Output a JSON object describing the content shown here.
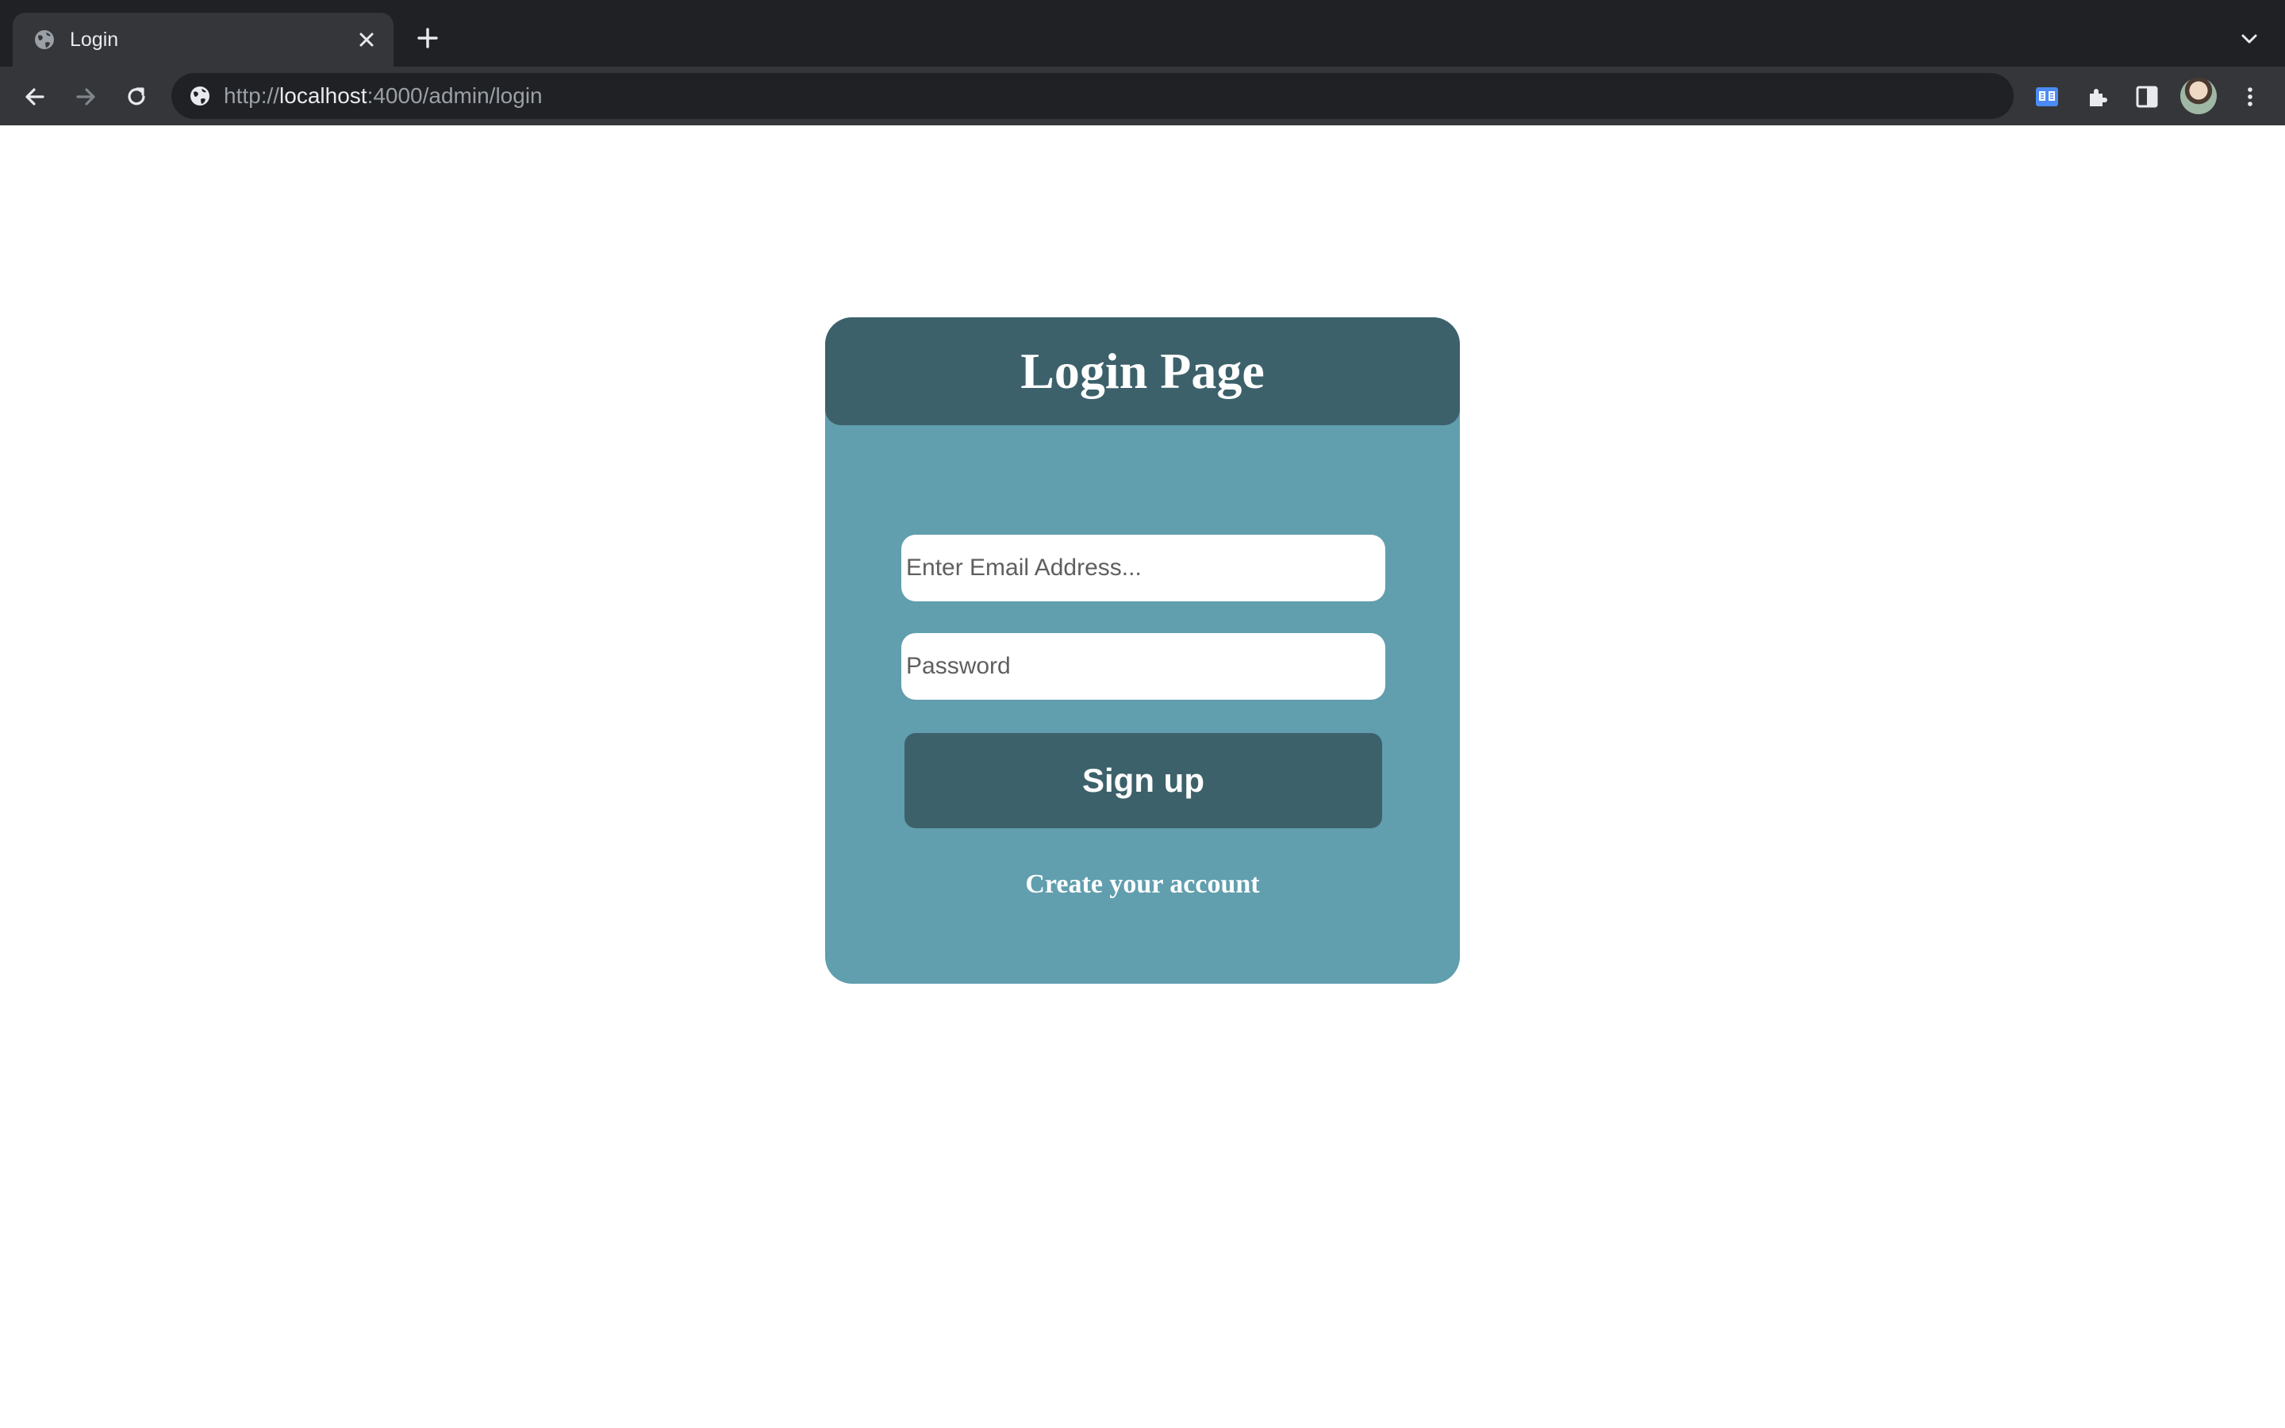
{
  "browser": {
    "tab": {
      "title": "Login",
      "favicon": "globe-icon",
      "close_icon": "close-icon"
    },
    "new_tab_icon": "plus-icon",
    "tab_search_icon": "chevron-down-icon",
    "address_bar": {
      "scheme": "http://",
      "host": "localhost",
      "rest": ":4000/admin/login",
      "site_icon": "globe-icon"
    },
    "toolbar_icons": [
      "back-icon",
      "forward-icon",
      "reload-icon",
      "reading-mode-icon",
      "extensions-icon",
      "side-panel-icon",
      "profile-avatar",
      "menu-icon"
    ],
    "colors": {
      "tabstrip": "#202124",
      "toolbar": "#35363a",
      "omnibox": "#202124"
    }
  },
  "login": {
    "title": "Login Page",
    "email": {
      "placeholder": "Enter Email Address...",
      "value": ""
    },
    "password": {
      "placeholder": "Password",
      "value": ""
    },
    "submit_label": "Sign up",
    "create_account_label": "Create your account",
    "colors": {
      "card": "#619eae",
      "header": "#3c616b",
      "button": "#3c616b",
      "text": "#ffffff"
    }
  }
}
